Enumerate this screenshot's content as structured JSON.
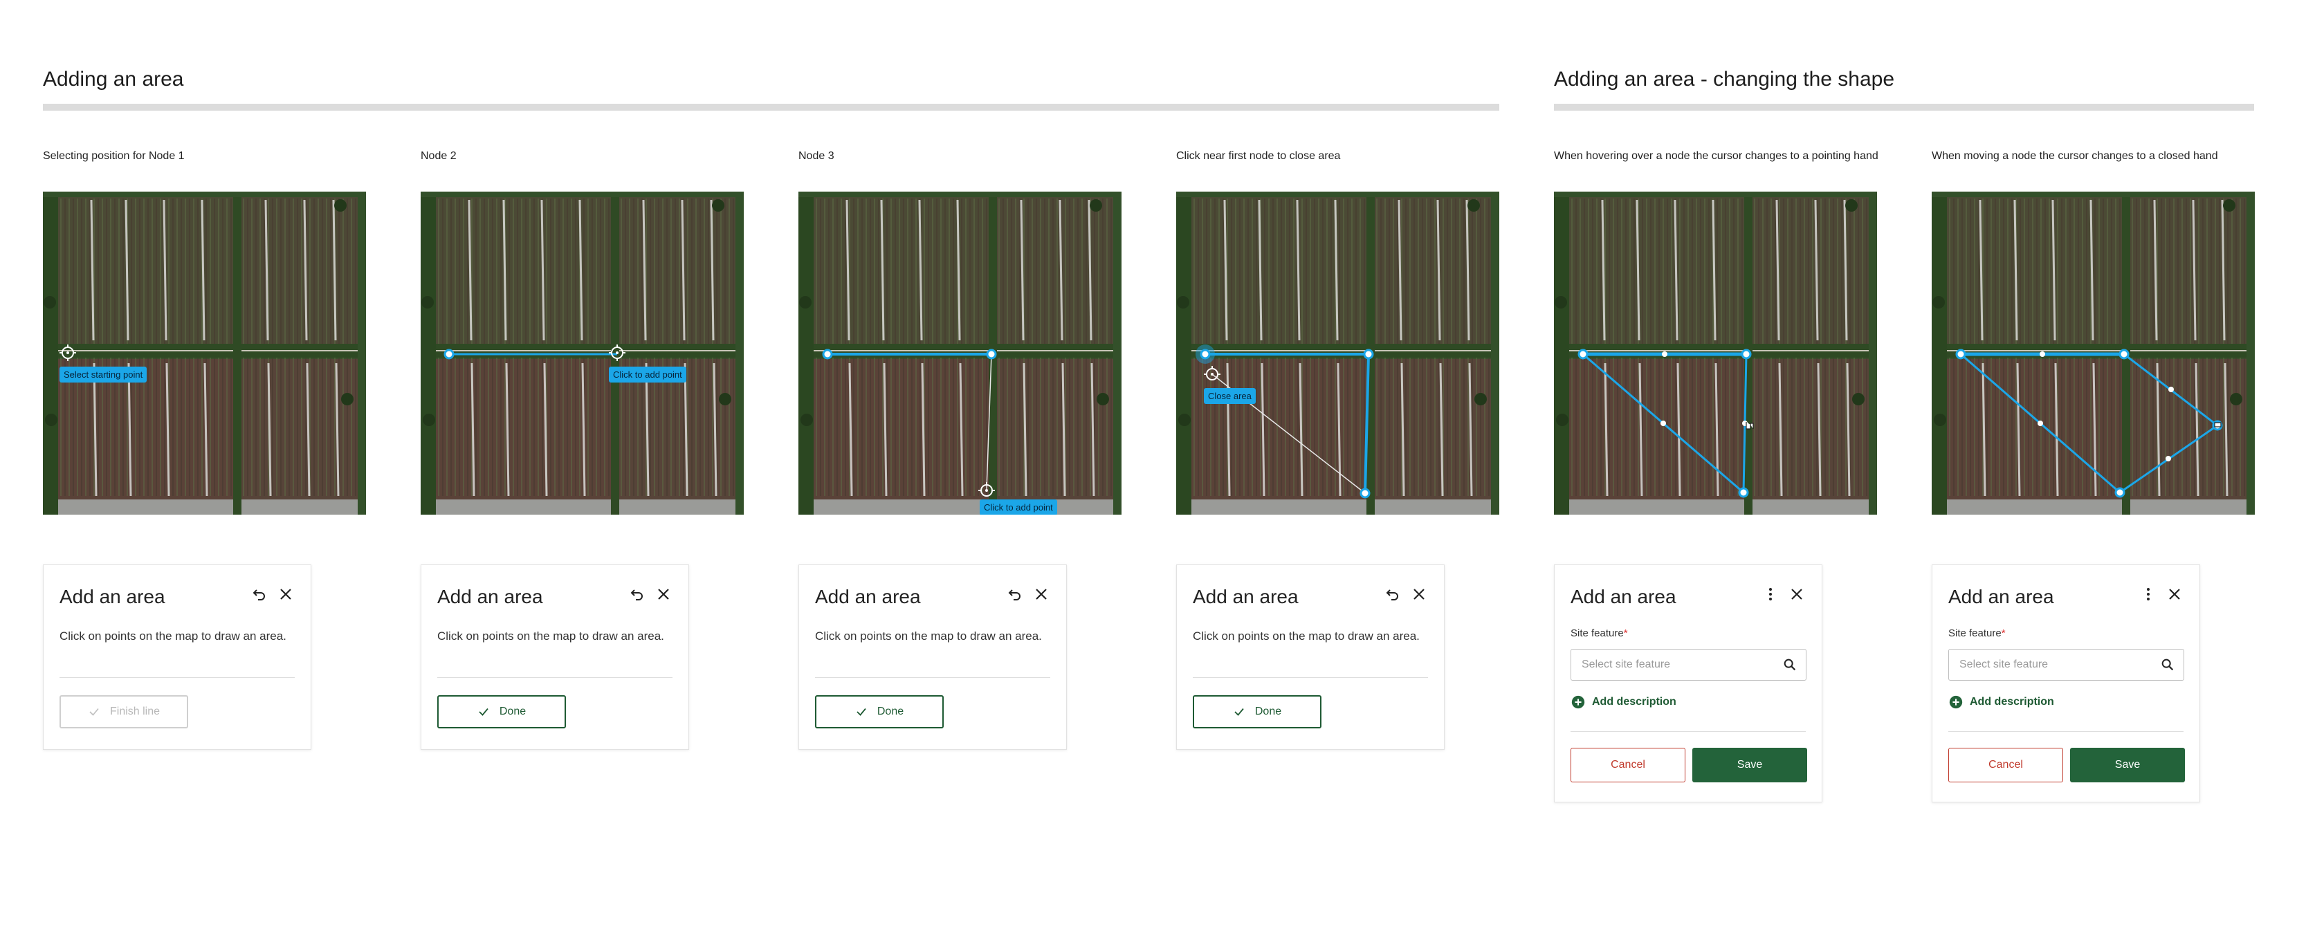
{
  "sections": [
    {
      "title": "Adding an area"
    },
    {
      "title": "Adding an area - changing the shape"
    }
  ],
  "captions": [
    "Selecting position for Node 1",
    "Node 2",
    "Node 3",
    "Click near first node to close area",
    "When hovering over a node the cursor changes to a pointing hand",
    "When moving a node the cursor changes to a closed hand"
  ],
  "tooltips": {
    "select_start": "Select starting point",
    "click_add": "Click to add point",
    "close_area": "Close area"
  },
  "draw_panel": {
    "title": "Add an area",
    "description": "Click on points on the map to draw an area.",
    "finish_label": "Finish line",
    "done_label": "Done"
  },
  "edit_panel": {
    "title": "Add an area",
    "field_label": "Site feature",
    "required_mark": "*",
    "search_placeholder": "Select site feature",
    "add_description_label": "Add description",
    "cancel_label": "Cancel",
    "save_label": "Save"
  },
  "icons": [
    "undo-icon",
    "close-icon",
    "check-icon",
    "search-icon",
    "more-vertical-icon",
    "plus-circle-icon",
    "crosshair-cursor-icon",
    "hand-cursor-icon"
  ],
  "colors": {
    "accent_blue": "#1ba6e8",
    "brand_green": "#23633a",
    "cancel_red": "#c0392b",
    "rule_gray": "#dcdcdc"
  }
}
